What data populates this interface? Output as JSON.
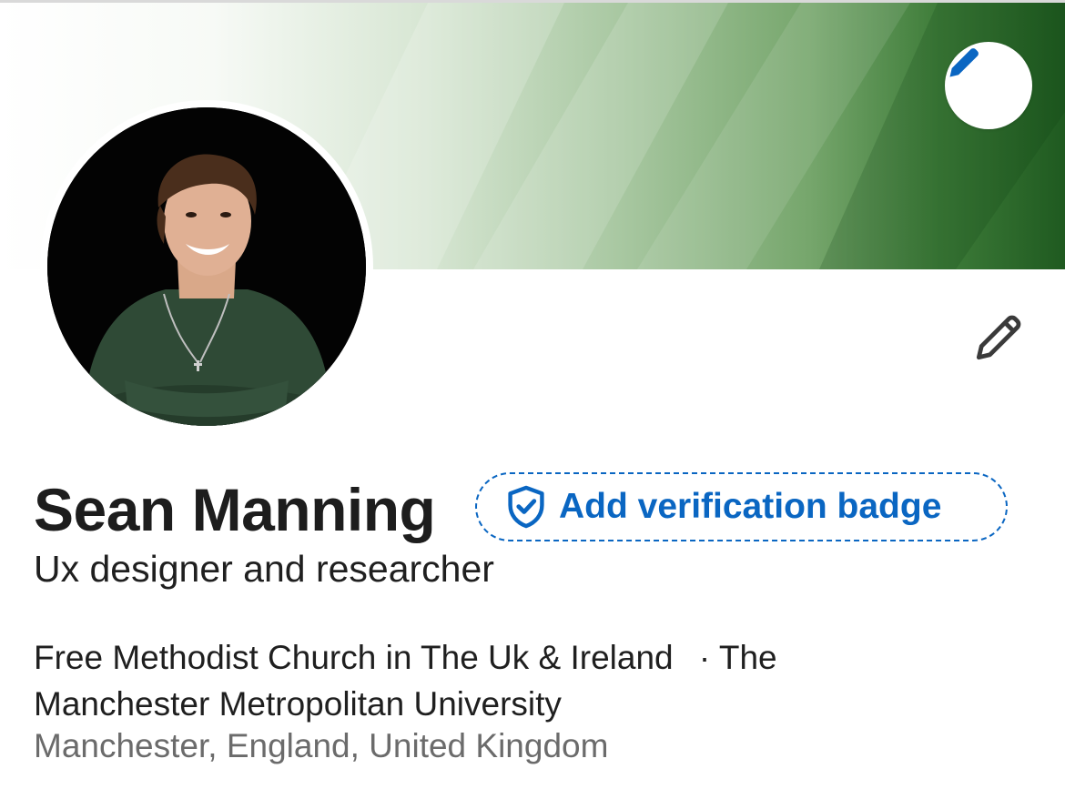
{
  "profile": {
    "name": "Sean Manning",
    "headline": "Ux designer and researcher",
    "organization": "Free Methodist Church in The Uk & Ireland",
    "separator": "·",
    "education": "The Manchester Metropolitan University",
    "location": "Manchester, England, United Kingdom"
  },
  "verification": {
    "label": "Add verification badge",
    "icon": "shield-check-icon"
  },
  "cover": {
    "edit_icon": "pencil-icon",
    "accent": "#1f5a20"
  },
  "actions": {
    "edit_profile_icon": "pencil-icon"
  },
  "colors": {
    "link_blue": "#0a66c2",
    "text_primary": "#1d1d1d",
    "text_secondary": "#6b6b6b"
  }
}
